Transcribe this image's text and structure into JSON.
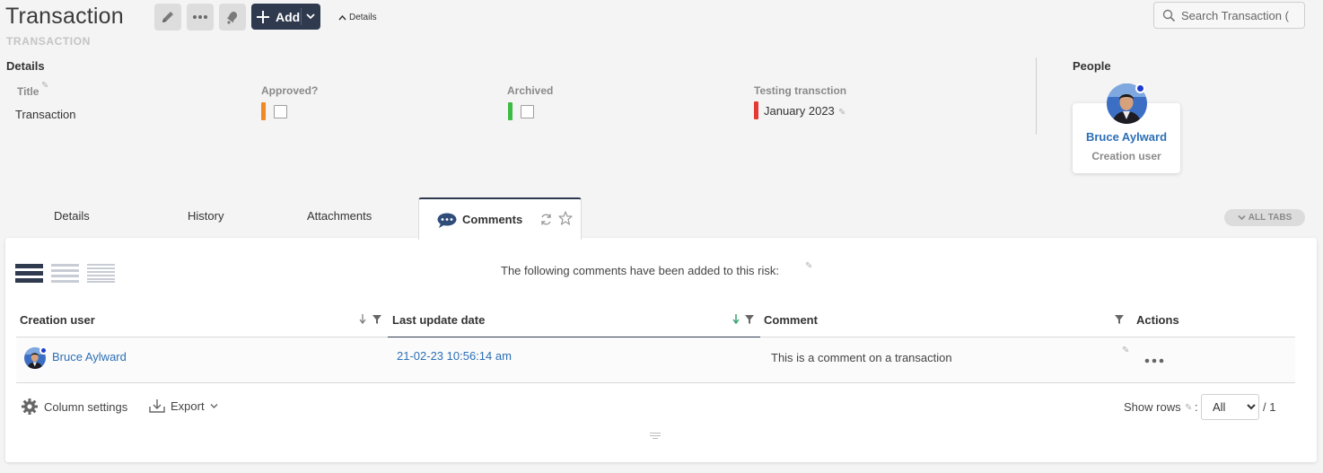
{
  "header": {
    "title": "Transaction",
    "subtitle": "TRANSACTION",
    "add_label": "Add",
    "details_toggle": "Details",
    "search_placeholder": "Search Transaction ("
  },
  "details": {
    "heading": "Details",
    "fields": [
      {
        "label": "Title",
        "value": "Transaction"
      },
      {
        "label": "Approved?",
        "status_color": "#f08a24"
      },
      {
        "label": "Archived",
        "status_color": "#3cbc44"
      },
      {
        "label": "Testing transction",
        "value": "January 2023",
        "status_color": "#e53935"
      }
    ]
  },
  "people": {
    "heading": "People",
    "person": {
      "name": "Bruce Aylward",
      "role": "Creation user"
    }
  },
  "tabs": {
    "items": [
      "Details",
      "History",
      "Attachments"
    ],
    "active": "Comments",
    "all_tabs": "ALL TABS"
  },
  "comments": {
    "intro": "The following comments have been added to this risk:",
    "columns": [
      "Creation user",
      "Last update date",
      "Comment",
      "Actions"
    ],
    "rows": [
      {
        "user": "Bruce Aylward",
        "date": "21-02-23 10:56:14 am",
        "comment": "This is a comment on a transaction"
      }
    ],
    "footer": {
      "column_settings": "Column settings",
      "export": "Export",
      "show_rows": "Show rows",
      "rows_value": "All",
      "page_total": "/ 1"
    }
  },
  "colors": {
    "primary": "#2f3a4f",
    "link": "#2c6fb5",
    "sort_active": "#2e9e6a"
  }
}
